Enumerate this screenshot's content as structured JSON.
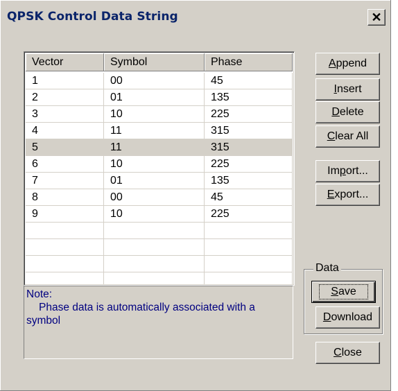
{
  "window": {
    "title": "QPSK Control Data String",
    "close_glyph": "✕"
  },
  "table": {
    "columns": [
      "Vector",
      "Symbol",
      "Phase"
    ],
    "rows": [
      [
        "1",
        "00",
        "45"
      ],
      [
        "2",
        "01",
        "135"
      ],
      [
        "3",
        "10",
        "225"
      ],
      [
        "4",
        "11",
        "315"
      ],
      [
        "5",
        "11",
        "315"
      ],
      [
        "6",
        "10",
        "225"
      ],
      [
        "7",
        "01",
        "135"
      ],
      [
        "8",
        "00",
        "45"
      ],
      [
        "9",
        "10",
        "225"
      ],
      [
        "",
        "",
        ""
      ],
      [
        "",
        "",
        ""
      ],
      [
        "",
        "",
        ""
      ],
      [
        "",
        "",
        ""
      ]
    ],
    "selected_row": 4
  },
  "note": {
    "line1": "Note:",
    "line2": "Phase data is automatically associated with a",
    "line3": "symbol"
  },
  "buttons": {
    "append": {
      "mn": "A",
      "rest": "ppend"
    },
    "insert": {
      "mn": "I",
      "rest": "nsert"
    },
    "delete": {
      "mn": "D",
      "rest": "elete"
    },
    "clear_all": {
      "mn": "C",
      "rest": "lear All"
    },
    "import": {
      "pre": "Im",
      "mn": "p",
      "rest": "ort..."
    },
    "export": {
      "mn": "E",
      "rest": "xport..."
    },
    "save": {
      "mn": "S",
      "rest": "ave"
    },
    "download": {
      "mn": "D",
      "rest": "ownload"
    },
    "close": {
      "mn": "C",
      "rest": "lose"
    }
  },
  "group": {
    "label": "Data"
  }
}
